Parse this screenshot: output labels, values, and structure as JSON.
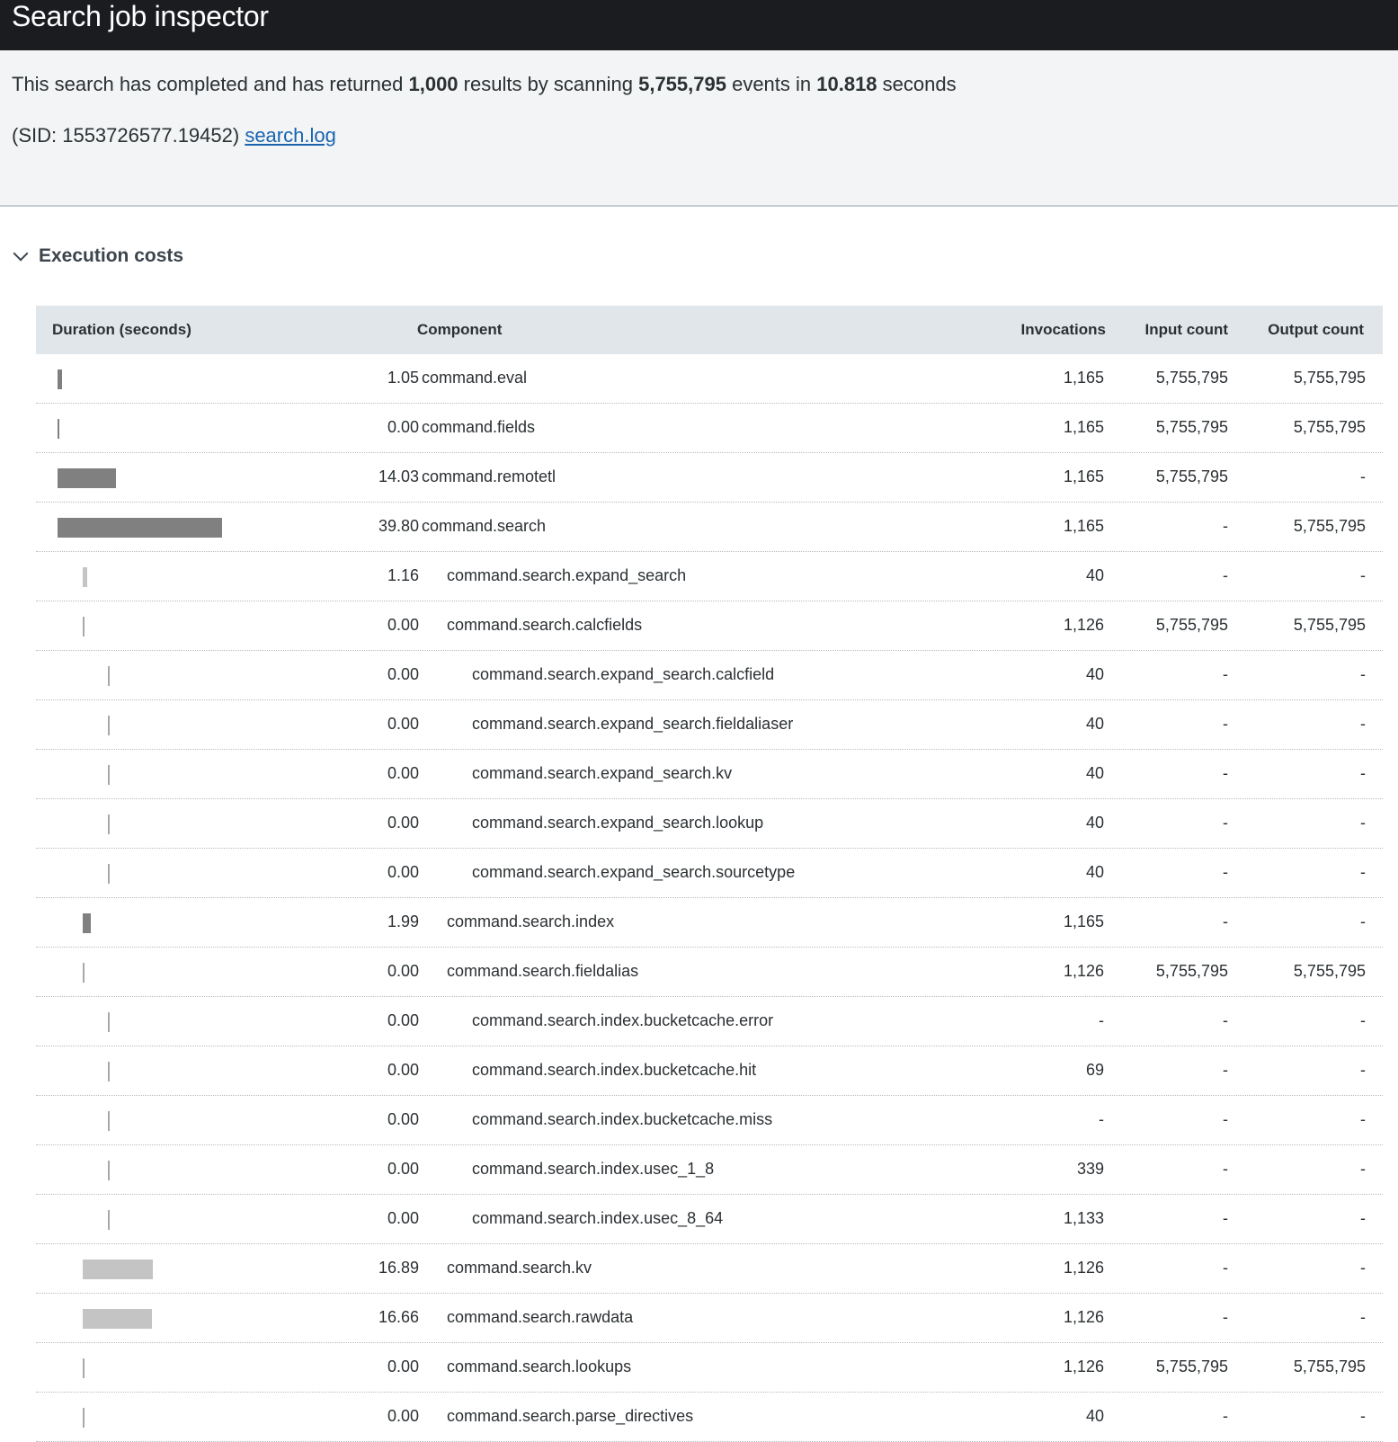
{
  "title": "Search job inspector",
  "summary": {
    "prefix": "This search has completed and has returned ",
    "results": "1,000",
    "mid1": " results by scanning ",
    "events": "5,755,795",
    "mid2": " events in ",
    "seconds": "10.818",
    "suffix": " seconds",
    "sid_text": "(SID: 1553726577.19452) ",
    "log_link": "search.log"
  },
  "section": {
    "title": "Execution costs"
  },
  "columns": {
    "duration": "Duration (seconds)",
    "component": "Component",
    "invocations": "Invocations",
    "input_count": "Input count",
    "output_count": "Output count"
  },
  "rows": [
    {
      "duration": "1.05",
      "component": "command.eval",
      "invocations": "1,165",
      "input_count": "5,755,795",
      "output_count": "5,755,795",
      "level": 0,
      "bar_value": 1.05,
      "bar_shade": "dark"
    },
    {
      "duration": "0.00",
      "component": "command.fields",
      "invocations": "1,165",
      "input_count": "5,755,795",
      "output_count": "5,755,795",
      "level": 0,
      "bar_value": 0.0,
      "bar_shade": "dark"
    },
    {
      "duration": "14.03",
      "component": "command.remotetl",
      "invocations": "1,165",
      "input_count": "5,755,795",
      "output_count": "-",
      "level": 0,
      "bar_value": 14.03,
      "bar_shade": "dark"
    },
    {
      "duration": "39.80",
      "component": "command.search",
      "invocations": "1,165",
      "input_count": "-",
      "output_count": "5,755,795",
      "level": 0,
      "bar_value": 39.8,
      "bar_shade": "dark"
    },
    {
      "duration": "1.16",
      "component": "command.search.expand_search",
      "invocations": "40",
      "input_count": "-",
      "output_count": "-",
      "level": 1,
      "bar_value": 1.16,
      "bar_shade": "light"
    },
    {
      "duration": "0.00",
      "component": "command.search.calcfields",
      "invocations": "1,126",
      "input_count": "5,755,795",
      "output_count": "5,755,795",
      "level": 1,
      "bar_value": 0.0,
      "bar_shade": "light"
    },
    {
      "duration": "0.00",
      "component": "command.search.expand_search.calcfield",
      "invocations": "40",
      "input_count": "-",
      "output_count": "-",
      "level": 2,
      "bar_value": 0.0,
      "bar_shade": "light"
    },
    {
      "duration": "0.00",
      "component": "command.search.expand_search.fieldaliaser",
      "invocations": "40",
      "input_count": "-",
      "output_count": "-",
      "level": 2,
      "bar_value": 0.0,
      "bar_shade": "light"
    },
    {
      "duration": "0.00",
      "component": "command.search.expand_search.kv",
      "invocations": "40",
      "input_count": "-",
      "output_count": "-",
      "level": 2,
      "bar_value": 0.0,
      "bar_shade": "light"
    },
    {
      "duration": "0.00",
      "component": "command.search.expand_search.lookup",
      "invocations": "40",
      "input_count": "-",
      "output_count": "-",
      "level": 2,
      "bar_value": 0.0,
      "bar_shade": "light"
    },
    {
      "duration": "0.00",
      "component": "command.search.expand_search.sourcetype",
      "invocations": "40",
      "input_count": "-",
      "output_count": "-",
      "level": 2,
      "bar_value": 0.0,
      "bar_shade": "light"
    },
    {
      "duration": "1.99",
      "component": "command.search.index",
      "invocations": "1,165",
      "input_count": "-",
      "output_count": "-",
      "level": 1,
      "bar_value": 1.99,
      "bar_shade": "dark"
    },
    {
      "duration": "0.00",
      "component": "command.search.fieldalias",
      "invocations": "1,126",
      "input_count": "5,755,795",
      "output_count": "5,755,795",
      "level": 1,
      "bar_value": 0.0,
      "bar_shade": "light"
    },
    {
      "duration": "0.00",
      "component": "command.search.index.bucketcache.error",
      "invocations": "-",
      "input_count": "-",
      "output_count": "-",
      "level": 2,
      "bar_value": 0.0,
      "bar_shade": "light"
    },
    {
      "duration": "0.00",
      "component": "command.search.index.bucketcache.hit",
      "invocations": "69",
      "input_count": "-",
      "output_count": "-",
      "level": 2,
      "bar_value": 0.0,
      "bar_shade": "light"
    },
    {
      "duration": "0.00",
      "component": "command.search.index.bucketcache.miss",
      "invocations": "-",
      "input_count": "-",
      "output_count": "-",
      "level": 2,
      "bar_value": 0.0,
      "bar_shade": "light"
    },
    {
      "duration": "0.00",
      "component": "command.search.index.usec_1_8",
      "invocations": "339",
      "input_count": "-",
      "output_count": "-",
      "level": 2,
      "bar_value": 0.0,
      "bar_shade": "light"
    },
    {
      "duration": "0.00",
      "component": "command.search.index.usec_8_64",
      "invocations": "1,133",
      "input_count": "-",
      "output_count": "-",
      "level": 2,
      "bar_value": 0.0,
      "bar_shade": "light"
    },
    {
      "duration": "16.89",
      "component": "command.search.kv",
      "invocations": "1,126",
      "input_count": "-",
      "output_count": "-",
      "level": 1,
      "bar_value": 16.89,
      "bar_shade": "light"
    },
    {
      "duration": "16.66",
      "component": "command.search.rawdata",
      "invocations": "1,126",
      "input_count": "-",
      "output_count": "-",
      "level": 1,
      "bar_value": 16.66,
      "bar_shade": "light"
    },
    {
      "duration": "0.00",
      "component": "command.search.lookups",
      "invocations": "1,126",
      "input_count": "5,755,795",
      "output_count": "5,755,795",
      "level": 1,
      "bar_value": 0.0,
      "bar_shade": "light"
    },
    {
      "duration": "0.00",
      "component": "command.search.parse_directives",
      "invocations": "40",
      "input_count": "-",
      "output_count": "-",
      "level": 1,
      "bar_value": 0.0,
      "bar_shade": "light"
    }
  ]
}
